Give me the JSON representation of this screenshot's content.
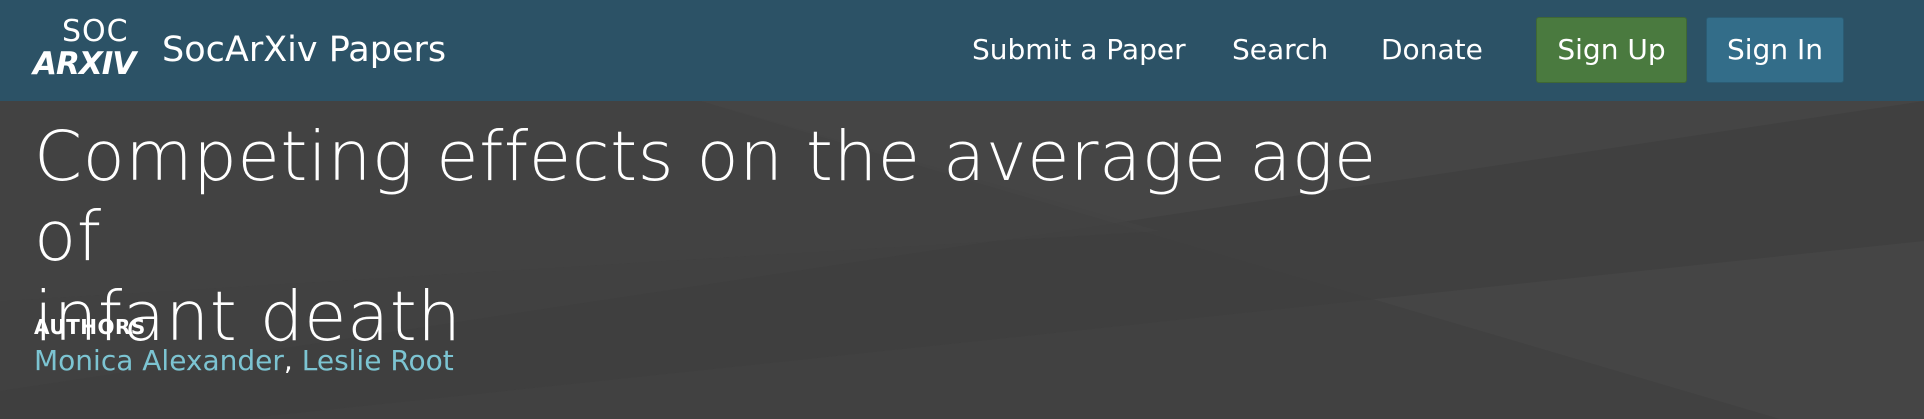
{
  "navbar": {
    "logo": {
      "top": "SOC",
      "bottom": "ARXIV"
    },
    "brand": "SocArXiv Papers",
    "links": {
      "submit": "Submit a Paper",
      "search": "Search",
      "donate": "Donate"
    },
    "buttons": {
      "signup": "Sign Up",
      "signin": "Sign In"
    },
    "colors": {
      "bar": "#2c5266",
      "signup": "#4a7a3f",
      "signin": "#336d89"
    }
  },
  "paper": {
    "title_line1": "Competing effects on the average age of",
    "title_line2": "infant death",
    "authors_label": "AUTHORS",
    "authors": [
      "Monica Alexander",
      "Leslie Root"
    ],
    "separator": ", "
  },
  "colors": {
    "hero_bg": "#414141",
    "author_link": "#7cc4d2"
  }
}
